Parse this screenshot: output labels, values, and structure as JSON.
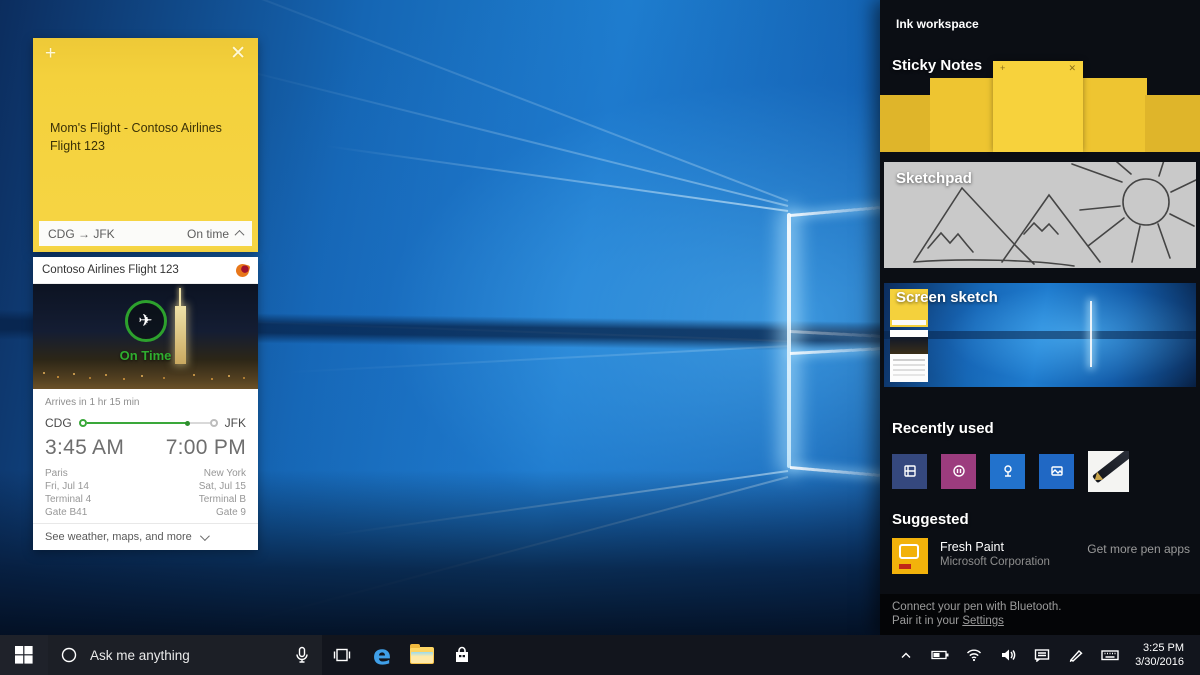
{
  "icons": {
    "plus": "+",
    "close": "✕",
    "plane": "✈",
    "edge": "e"
  },
  "sticky_note": {
    "text": "Mom's Flight - Contoso Airlines Flight 123",
    "route": "CDG → JFK",
    "status": "On time"
  },
  "flight_card": {
    "header": "Contoso Airlines Flight 123",
    "status_overlay": "On Time",
    "arrives": "Arrives in 1 hr 15 min",
    "origin_code": "CDG",
    "dest_code": "JFK",
    "progress_percent": 72,
    "depart_time": "3:45 AM",
    "arrive_time": "7:00 PM",
    "origin": {
      "city": "Paris",
      "date": "Fri, Jul 14",
      "terminal": "Terminal 4",
      "gate": "Gate B41"
    },
    "destination": {
      "city": "New York",
      "date": "Sat, Jul 15",
      "terminal": "Terminal B",
      "gate": "Gate 9"
    },
    "footer": "See weather, maps, and more"
  },
  "ink_panel": {
    "title": "Ink workspace",
    "sections": {
      "sticky_notes": "Sticky Notes",
      "sketchpad": "Sketchpad",
      "screen_sketch": "Screen sketch",
      "recently_used": "Recently used",
      "suggested": "Suggested"
    },
    "recently_used_apps": [
      {
        "name": "app-tile-1",
        "color": "#35487e"
      },
      {
        "name": "app-tile-2",
        "color": "#9c3c7e"
      },
      {
        "name": "app-tile-3",
        "color": "#2272cc"
      },
      {
        "name": "app-tile-4",
        "color": "#2068c4"
      },
      {
        "name": "pen-app-tile",
        "color": "#f4f4f2"
      }
    ],
    "suggested_app": {
      "name": "Fresh Paint",
      "publisher": "Microsoft Corporation",
      "link": "Get more pen apps"
    },
    "footer_line1": "Connect your pen with Bluetooth.",
    "footer_line2_prefix": "Pair it in your ",
    "footer_link": "Settings"
  },
  "taskbar": {
    "search_placeholder": "Ask me anything",
    "tray_icons": [
      "hidden-icons-chevron",
      "battery",
      "wifi",
      "volume",
      "action-center",
      "pen",
      "touch-keyboard"
    ],
    "clock": {
      "time": "3:25 PM",
      "date": "3/30/2016"
    }
  },
  "colors": {
    "note_yellow": "#f4d13c",
    "status_green": "#2fae2f",
    "panel_bg": "#0b0e14",
    "taskbar_bg": "#12151d",
    "wallpaper_blue": "#1e7ecf"
  }
}
